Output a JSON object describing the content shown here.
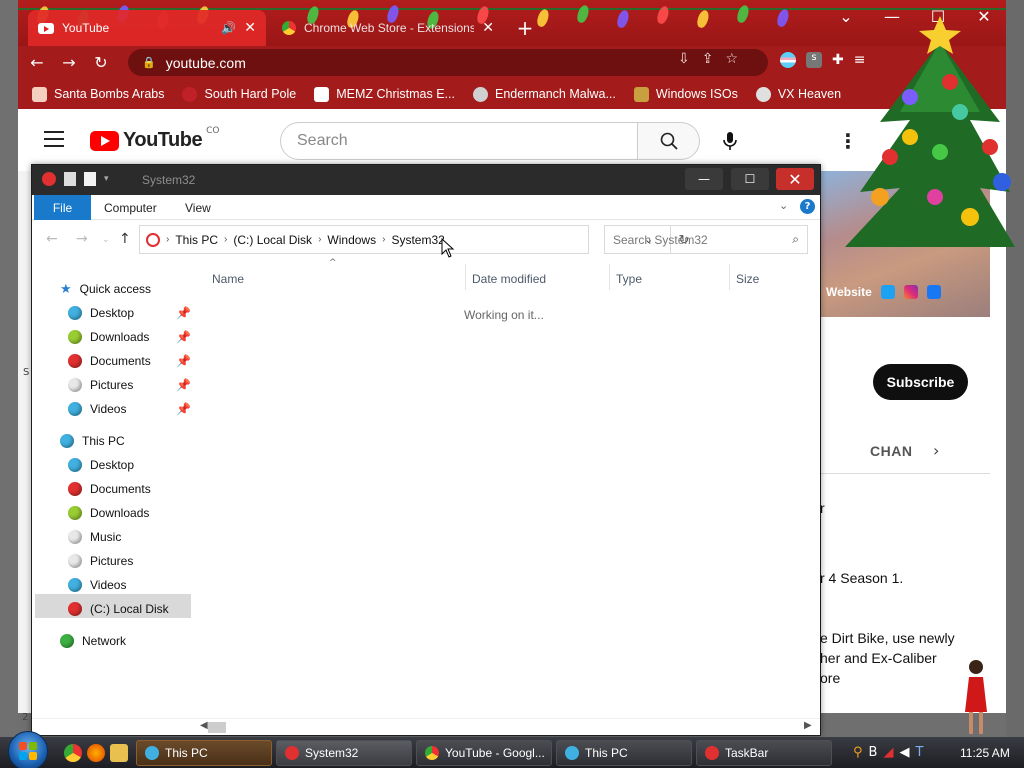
{
  "browser": {
    "tabs": [
      {
        "title": "YouTube",
        "active": true
      },
      {
        "title": "Chrome Web Store - Extensions",
        "active": false
      }
    ],
    "url": "youtube.com",
    "bookmarks": [
      {
        "label": "Santa Bombs Arabs",
        "color": "#f5d0c0"
      },
      {
        "label": "South Hard Pole",
        "color": "#c0202a"
      },
      {
        "label": "MEMZ Christmas E...",
        "color": "#ffffff"
      },
      {
        "label": "Endermanch Malwa...",
        "color": "#d0d0d0"
      },
      {
        "label": "Windows ISOs",
        "color": "#c8a040"
      },
      {
        "label": "VX Heaven",
        "color": "#e0e0e0"
      }
    ]
  },
  "youtube": {
    "logo_text": "YouTube",
    "country_code": "CO",
    "search_placeholder": "Search",
    "banner_link": "Website",
    "subscribe_label": "Subscribe",
    "channel_tab": "CHAN",
    "desc_lines": [
      "r",
      "r 4 Season 1.",
      "e Dirt Bike, use newly",
      "her and Ex-Caliber",
      "ore"
    ],
    "left_edge_chars": [
      "S",
      "2"
    ]
  },
  "explorer": {
    "title": "System32",
    "ribbon_tabs": [
      "File",
      "Computer",
      "View"
    ],
    "help_label": "?",
    "breadcrumb": [
      "This PC",
      "(C:) Local Disk",
      "Windows",
      "System32"
    ],
    "search_placeholder": "Search System32",
    "columns": [
      "Name",
      "Date modified",
      "Type",
      "Size"
    ],
    "status": "Working on it...",
    "nav": {
      "quick_access": {
        "label": "Quick access",
        "items": [
          {
            "label": "Desktop",
            "color": "#40b0e0"
          },
          {
            "label": "Downloads",
            "color": "#9acd32"
          },
          {
            "label": "Documents",
            "color": "#e03030"
          },
          {
            "label": "Pictures",
            "color": "#e8e8e8"
          },
          {
            "label": "Videos",
            "color": "#40b0e0"
          }
        ]
      },
      "this_pc": {
        "label": "This PC",
        "items": [
          {
            "label": "Desktop",
            "color": "#40b0e0"
          },
          {
            "label": "Documents",
            "color": "#e03030"
          },
          {
            "label": "Downloads",
            "color": "#9acd32"
          },
          {
            "label": "Music",
            "color": "#e8e8e8"
          },
          {
            "label": "Pictures",
            "color": "#e8e8e8"
          },
          {
            "label": "Videos",
            "color": "#40b0e0"
          },
          {
            "label": "(C:) Local Disk",
            "color": "#e03030"
          }
        ]
      },
      "network": {
        "label": "Network",
        "color": "#3cb043"
      }
    }
  },
  "taskbar": {
    "tasks": [
      {
        "label": "This PC",
        "color": "#40b0e0"
      },
      {
        "label": "System32",
        "color": "#e03030"
      },
      {
        "label": "YouTube - Googl...",
        "color": "#f4c20d"
      },
      {
        "label": "This PC",
        "color": "#40b0e0"
      },
      {
        "label": "TaskBar",
        "color": "#e03030"
      }
    ],
    "clock": "11:25 AM"
  },
  "colors": {
    "chrome_frame": "#a31b1b",
    "explorer_accent": "#1979ca",
    "close_red": "#c7302a"
  }
}
